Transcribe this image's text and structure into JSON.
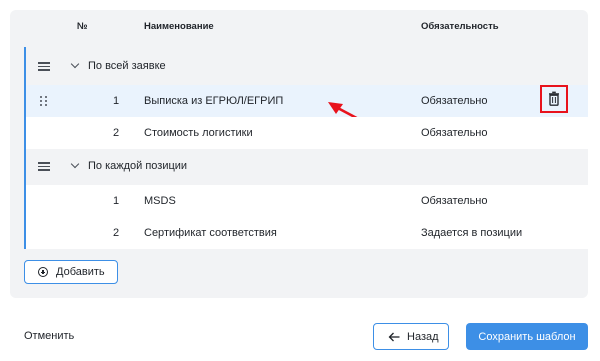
{
  "table": {
    "headers": {
      "num": "№",
      "name": "Наименование",
      "requirement": "Обязательность"
    },
    "groups": [
      {
        "title": "По всей заявке",
        "items": [
          {
            "num": "1",
            "name": "Выписка из ЕГРЮЛ/ЕГРИП",
            "requirement": "Обязательно"
          },
          {
            "num": "2",
            "name": "Стоимость логистики",
            "requirement": "Обязательно"
          }
        ]
      },
      {
        "title": "По каждой позиции",
        "items": [
          {
            "num": "1",
            "name": "MSDS",
            "requirement": "Обязательно"
          },
          {
            "num": "2",
            "name": "Сертификат соответствия",
            "requirement": "Задается в позиции"
          }
        ]
      }
    ]
  },
  "actions": {
    "add_label": "Добавить",
    "cancel_label": "Отменить",
    "back_label": "Назад",
    "save_label": "Сохранить шаблон"
  },
  "colors": {
    "accent": "#3d8fe6",
    "highlight": "#e8121c",
    "panel_bg": "#f2f3f5",
    "selected_row": "#eaf3fd"
  },
  "icons": [
    "list-icon",
    "chevron-down-icon",
    "drag-handle-icon",
    "trash-icon",
    "plus-circle-icon",
    "arrow-left-icon",
    "annotation-arrow"
  ]
}
